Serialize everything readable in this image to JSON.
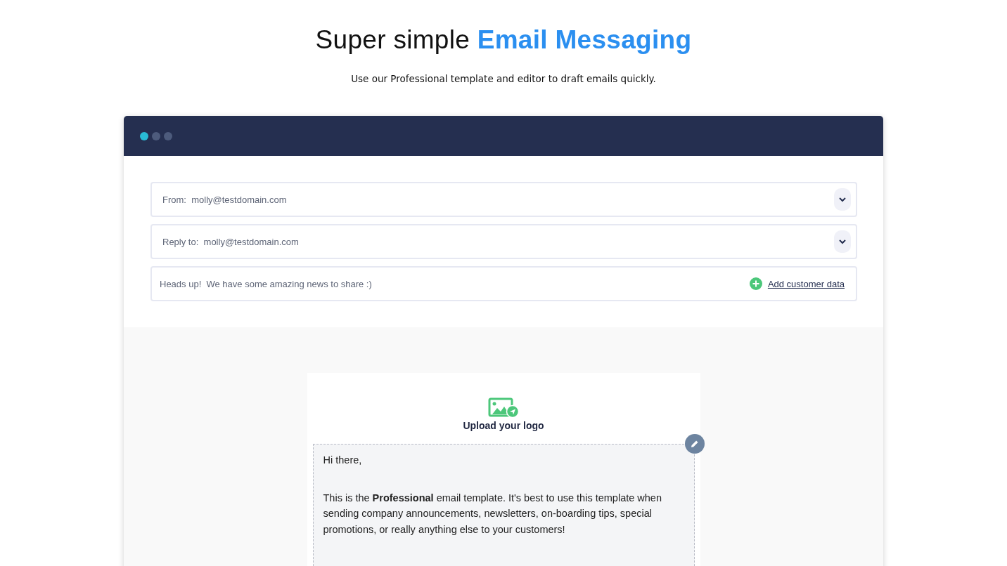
{
  "heading": "Super simple **Email Messaging**",
  "subheading": "Use our Professional template and editor to draft emails quickly.",
  "window_dots": [
    {
      "color": "#29bcd6"
    },
    {
      "color": "#4d5b7c"
    },
    {
      "color": "#4d5b7c"
    }
  ],
  "fields": [
    {
      "kind": "dropdown",
      "label": "From:",
      "value": "molly@testdomain.com"
    },
    {
      "kind": "dropdown",
      "label": "Reply to:",
      "value": "molly@testdomain.com"
    },
    {
      "kind": "subject",
      "value": "Heads up!  We have some amazing news to share :)",
      "link": "Add customer data"
    }
  ],
  "email": {
    "logo_label": "Upload your logo",
    "greeting": "Hi there,",
    "body": "This is the **Professional** email template.  It's best to use this template when sending company announcements, newsletters, on-boarding tips, special promotions, or really anything else to your customers!"
  }
}
